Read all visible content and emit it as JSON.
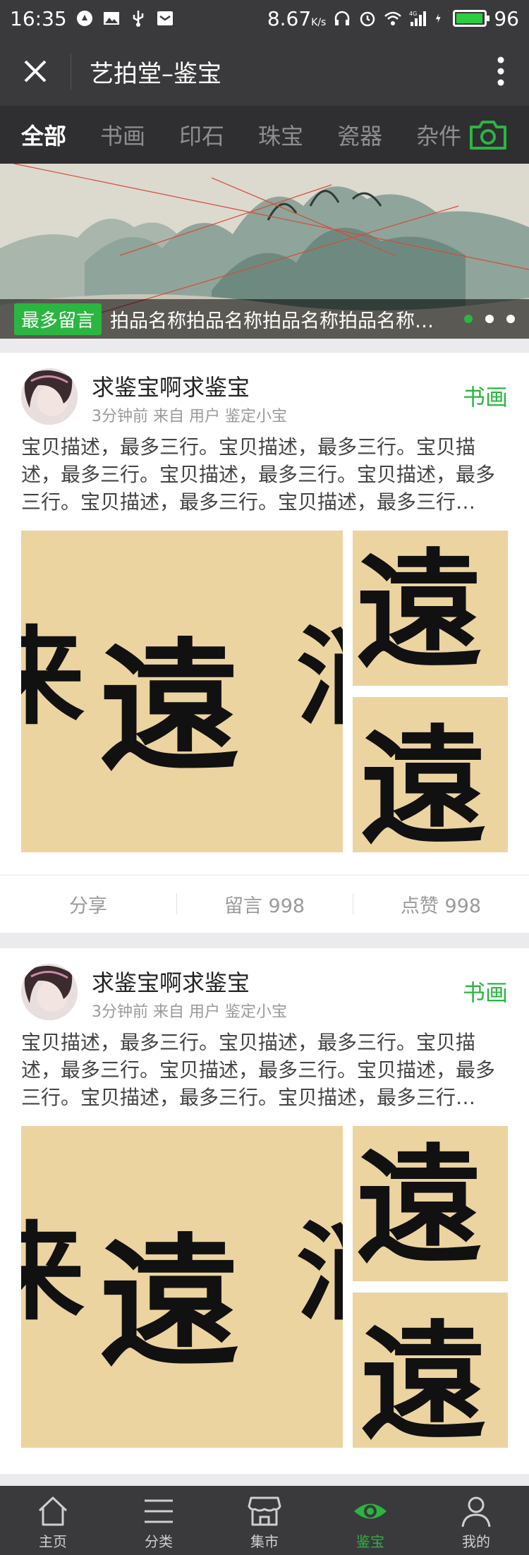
{
  "status": {
    "time": "16:35",
    "speed": "8.67",
    "speed_unit": "K/s",
    "battery": "96",
    "battery_level": 0.96,
    "network": "4G"
  },
  "titlebar": {
    "title": "艺拍堂–鉴宝",
    "close_icon": "close-icon",
    "more_icon": "more-vertical-icon"
  },
  "tabs": [
    "全部",
    "书画",
    "印石",
    "珠宝",
    "瓷器",
    "杂件"
  ],
  "banner": {
    "badge": "最多留言",
    "title": "拍品名称拍品名称拍品名称拍品名称拍品名称",
    "dots_count": 3,
    "active_dot": 0
  },
  "posts": [
    {
      "user": "求鉴宝啊求鉴宝",
      "meta": "3分钟前   来自 用户 鉴定小宝",
      "category": "书画",
      "description": "宝贝描述，最多三行。宝贝描述，最多三行。宝贝描述，最多三行。宝贝描述，最多三行。宝贝描述，最多三行。宝贝描述，最多三行。宝贝描述，最多三行…",
      "share": "分享",
      "comments": "留言 998",
      "likes": "点赞 998"
    },
    {
      "user": "求鉴宝啊求鉴宝",
      "meta": "3分钟前   来自 用户 鉴定小宝",
      "category": "书画",
      "description": "宝贝描述，最多三行。宝贝描述，最多三行。宝贝描述，最多三行。宝贝描述，最多三行。宝贝描述，最多三行。宝贝描述，最多三行。宝贝描述，最多三行…",
      "share": "分享",
      "comments": "留言 998",
      "likes": "点赞 998"
    }
  ],
  "bottomnav": [
    {
      "label": "主页",
      "icon": "home-icon"
    },
    {
      "label": "分类",
      "icon": "menu-icon"
    },
    {
      "label": "集市",
      "icon": "shop-icon"
    },
    {
      "label": "鉴宝",
      "icon": "eye-icon"
    },
    {
      "label": "我的",
      "icon": "user-icon"
    }
  ],
  "colors": {
    "accent": "#2ab640",
    "bar": "#3a3a3c",
    "tabs_bg": "#2f2f31",
    "paper": "#ecd4a0"
  }
}
